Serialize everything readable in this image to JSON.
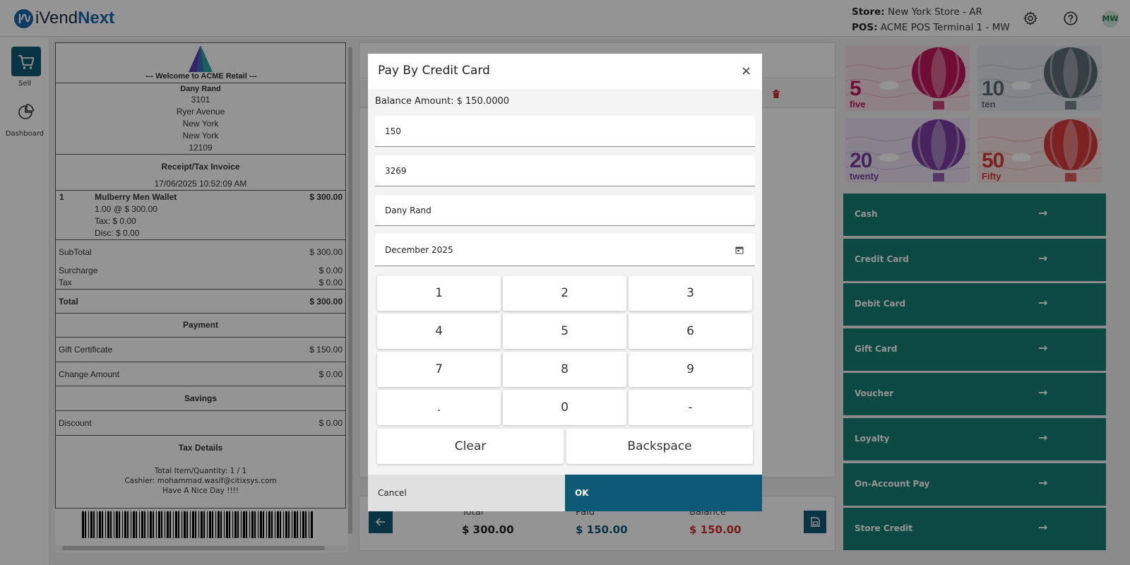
{
  "header": {
    "logo_plain": "iVend",
    "logo_bold": "Next",
    "store_label": "Store:",
    "store_value": "New York Store - AR",
    "pos_label": "POS:",
    "pos_value": "ACME POS Terminal 1 - MW",
    "avatar_initials": "MW"
  },
  "nav": {
    "sell_label": "Sell",
    "dashboard_label": "Dashboard"
  },
  "receipt": {
    "welcome": "--- Welcome to ACME Retail ---",
    "customer": "Dany Rand",
    "address_lines": [
      "3101",
      "Ryer Avenue",
      "New York",
      "New York",
      "12109"
    ],
    "invoice_title": "Receipt/Tax Invoice",
    "datetime": "17/06/2025 10:52:09 AM",
    "item": {
      "qty": "1",
      "name": "Mulberry Men Wallet",
      "amount": "$ 300.00",
      "detail_qty": "1.00 @ $ 300.00",
      "detail_tax": "Tax: $ 0.00",
      "detail_disc": "Disc: $ 0.00"
    },
    "subtotal_label": "SubTotal",
    "subtotal_value": "$ 300.00",
    "surcharge_label": "Surcharge",
    "surcharge_value": "$ 0.00",
    "tax_label": "Tax",
    "tax_value": "$ 0.00",
    "total_label": "Total",
    "total_value": "$ 300.00",
    "payment_title": "Payment",
    "gift_label": "Gift Certificate",
    "gift_value": "$ 150.00",
    "change_label": "Change Amount",
    "change_value": "$ 0.00",
    "savings_title": "Savings",
    "discount_label": "Discount",
    "discount_value": "$ 0.00",
    "taxdetails_title": "Tax Details",
    "footer_qty": "Total Item/Quantity: 1 / 1",
    "footer_cashier": "Cashier: mohammad.wasif@citixsys.com",
    "footer_bye": "Have A Nice Day !!!!"
  },
  "totals": {
    "total_label": "Total",
    "total_value": "$ 300.00",
    "paid_label": "Paid",
    "paid_value": "$ 150.00",
    "balance_label": "Balance",
    "balance_value": "$ 150.00",
    "colors": {
      "paid": "#0e5a76",
      "balance": "#d32f2f"
    }
  },
  "denominations": [
    {
      "num": "5",
      "word": "five",
      "color": "#c2185b",
      "bg": "#f3dfe6"
    },
    {
      "num": "10",
      "word": "ten",
      "color": "#5d6b78",
      "bg": "#e3e6ea"
    },
    {
      "num": "20",
      "word": "twenty",
      "color": "#7b3fa0",
      "bg": "#ebe1f1"
    },
    {
      "num": "50",
      "word": "Fifty",
      "color": "#d43a3a",
      "bg": "#f6e1e1"
    }
  ],
  "payment_methods": [
    {
      "label": "Cash"
    },
    {
      "label": "Credit Card"
    },
    {
      "label": "Debit Card"
    },
    {
      "label": "Gift Card"
    },
    {
      "label": "Voucher"
    },
    {
      "label": "Loyalty"
    },
    {
      "label": "On-Account Pay"
    },
    {
      "label": "Store Credit"
    }
  ],
  "modal": {
    "title": "Pay By Credit Card",
    "close": "×",
    "balance_text": "Balance Amount: $ 150.0000",
    "amount_value": "150",
    "card_last_digits": "3269",
    "card_holder": "Dany Rand",
    "expiry": "December 2025",
    "keys": [
      "1",
      "2",
      "3",
      "4",
      "5",
      "6",
      "7",
      "8",
      "9",
      ".",
      "0",
      "-"
    ],
    "clear_label": "Clear",
    "backspace_label": "Backspace",
    "cancel_label": "Cancel",
    "ok_label": "OK"
  },
  "arrow_glyph": "→"
}
